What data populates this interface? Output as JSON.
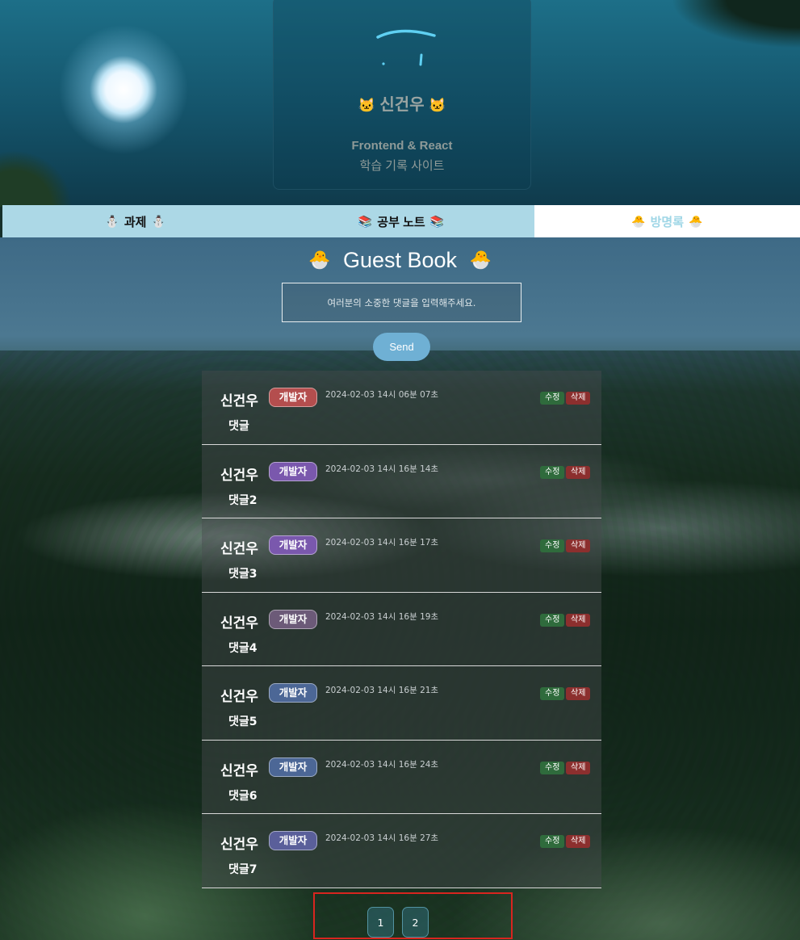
{
  "colors": {
    "tab_bg": "#acd8e6",
    "tab_active_bg": "#ffffff",
    "tab_active_text": "#9fd6e6",
    "send_button": "#6fb0d4",
    "edit_button": "#2f6b3c",
    "delete_button": "#8c2f2e",
    "pagination_outline": "#d8251f"
  },
  "profile": {
    "name": "신건우",
    "name_icon": "cat-face-icon",
    "subtitle_line1": "Frontend & React",
    "subtitle_line2": "학습 기록 사이트"
  },
  "nav": {
    "tabs": [
      {
        "label": "과제",
        "icon": "snowman-icon",
        "icon_glyph": "⛄",
        "active": false
      },
      {
        "label": "공부 노트",
        "icon": "books-icon",
        "icon_glyph": "📚",
        "active": false
      },
      {
        "label": "방명록",
        "icon": "hatching-chick-icon",
        "icon_glyph": "🐣",
        "active": true
      }
    ]
  },
  "guestbook": {
    "title": "Guest Book",
    "title_icon": "hatching-chick-icon",
    "input_placeholder": "여러분의 소중한 댓글을 입력해주세요.",
    "input_value": "",
    "send_label": "Send",
    "edit_label": "수정",
    "delete_label": "삭제",
    "comments": [
      {
        "author": "신건우",
        "badge": "개발자",
        "badge_color": "#b44e4e",
        "time": "2024-02-03 14시 06분 07초",
        "text": "댓글"
      },
      {
        "author": "신건우",
        "badge": "개발자",
        "badge_color": "#7a58ad",
        "time": "2024-02-03 14시 16분 14초",
        "text": "댓글2"
      },
      {
        "author": "신건우",
        "badge": "개발자",
        "badge_color": "#7a58ad",
        "time": "2024-02-03 14시 16분 17초",
        "text": "댓글3"
      },
      {
        "author": "신건우",
        "badge": "개발자",
        "badge_color": "#6c5a78",
        "time": "2024-02-03 14시 16분 19초",
        "text": "댓글4"
      },
      {
        "author": "신건우",
        "badge": "개발자",
        "badge_color": "#4c6796",
        "time": "2024-02-03 14시 16분 21초",
        "text": "댓글5"
      },
      {
        "author": "신건우",
        "badge": "개발자",
        "badge_color": "#4c6796",
        "time": "2024-02-03 14시 16분 24초",
        "text": "댓글6"
      },
      {
        "author": "신건우",
        "badge": "개발자",
        "badge_color": "#5a5f9a",
        "time": "2024-02-03 14시 16분 27초",
        "text": "댓글7"
      }
    ]
  },
  "pagination": {
    "pages": [
      "1",
      "2"
    ]
  }
}
